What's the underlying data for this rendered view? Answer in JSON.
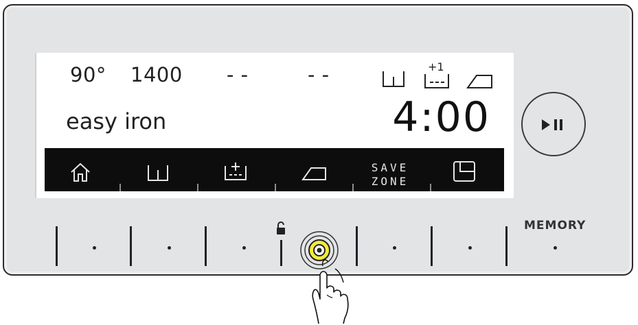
{
  "display": {
    "temperature": "90°",
    "spin": "1400",
    "option_a": "- -",
    "option_b": "- -",
    "program": "easy iron",
    "time": "4:00",
    "extra_rinse_badge": "+1"
  },
  "bottom_bar": {
    "items": [
      {
        "icon": "home-icon"
      },
      {
        "icon": "tub-icon"
      },
      {
        "icon": "extra-rinse-icon"
      },
      {
        "icon": "iron-icon"
      },
      {
        "label_line1": "SAVE",
        "label_line2": "ZONE"
      },
      {
        "icon": "timer-icon"
      }
    ]
  },
  "buttons": {
    "memory_label": "MEMORY",
    "start_pause_icon": "play-pause-icon",
    "lock_icon": "lock-icon"
  },
  "colors": {
    "panel": "#e3e4e6",
    "screen": "#ffffff",
    "bar": "#0d0d0d",
    "selected_ring": "#f2ea3a"
  }
}
